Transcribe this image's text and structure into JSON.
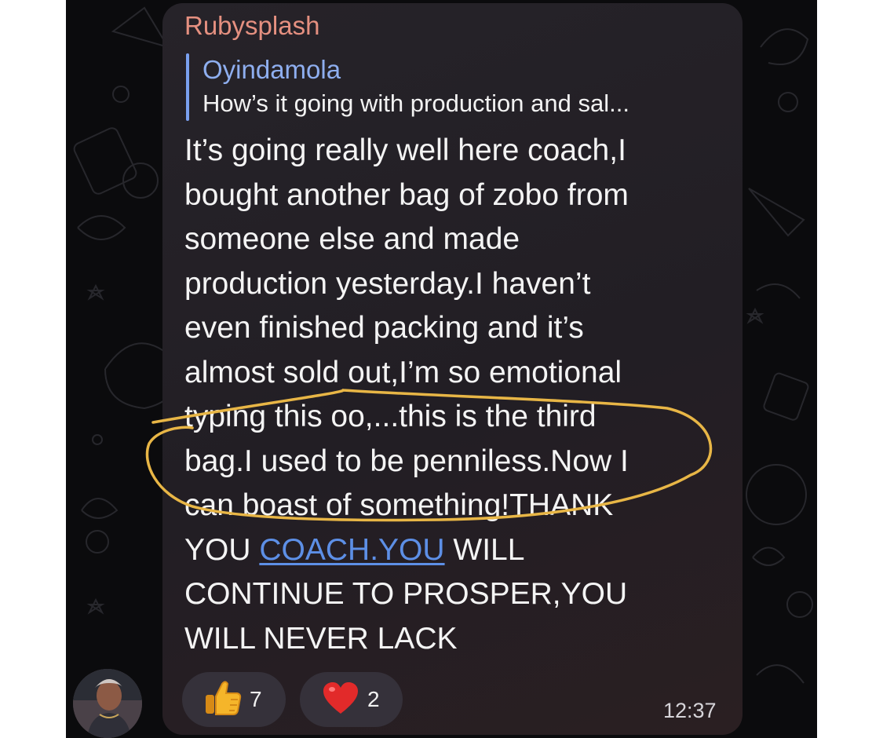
{
  "message": {
    "sender": "Rubysplash",
    "reply": {
      "name": "Oyindamola",
      "text": "How’s it going with production and sal..."
    },
    "lines": [
      "It’s going really well here coach,I",
      "bought another bag of zobo from",
      "someone else and made",
      "production yesterday.I haven’t",
      "even finished packing and it’s",
      "almost sold out,I’m so emotional",
      "typing this oo,...this is the third",
      "bag.I used to be penniless.Now I",
      "can boast of something!THANK"
    ],
    "line10_before": "YOU ",
    "line10_link": "COACH.YOU",
    "line10_after": " WILL",
    "lines_end": [
      "CONTINUE TO PROSPER,YOU",
      "WILL NEVER LACK"
    ],
    "time": "12:37"
  },
  "reactions": [
    {
      "emoji": "thumbs-up",
      "count": "7"
    },
    {
      "emoji": "red-heart",
      "count": "2"
    }
  ],
  "colors": {
    "sender": "#e59080",
    "reply_accent": "#7aa0ef",
    "link": "#5d8fe6",
    "highlight_stroke": "#e8b646",
    "bubble": "#252128",
    "background": "#0b0b0d"
  }
}
